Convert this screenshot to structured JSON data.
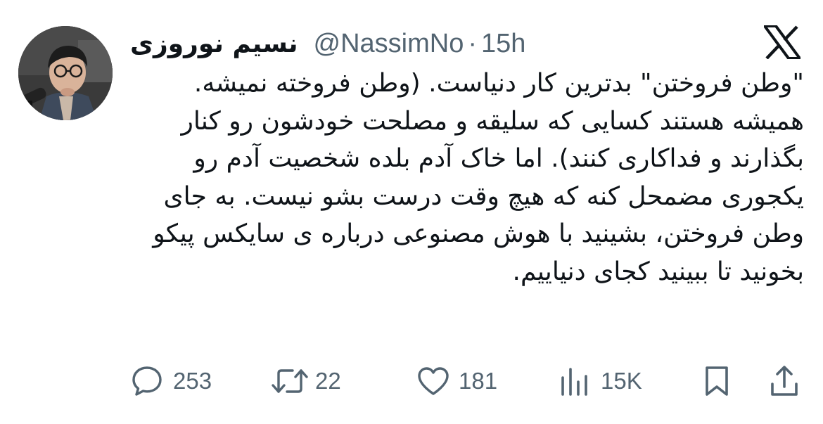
{
  "tweet": {
    "display_name": "نسیم نوروزی",
    "handle": "@NassimNo",
    "separator": "·",
    "time": "15h",
    "text": "\"وطن فروختن\" بدترین کار دنیاست. (وطن فروخته نمیشه. همیشه هستند کسایی که سلیقه و مصلحت خودشون رو کنار بگذارند و فداکاری کنند). اما خاک آدم بلده شخصیت آدم رو یکجوری مضمحل کنه که هیچ وقت درست بشو نیست. به جای وطن فروختن، بشینید با هوش مصنوعی درباره ی سایکس پیکو بخونید تا ببینید کجای دنیاییم."
  },
  "actions": {
    "replies": "253",
    "retweets": "22",
    "likes": "181",
    "views": "15K"
  },
  "icons": {
    "platform": "x-logo-icon",
    "reply": "comment-bubble-icon",
    "retweet": "retweet-icon",
    "like": "heart-icon",
    "views": "bar-chart-icon",
    "bookmark": "bookmark-icon",
    "share": "share-upload-icon"
  },
  "colors": {
    "text": "#0f1419",
    "secondary": "#536471",
    "background": "#ffffff"
  }
}
